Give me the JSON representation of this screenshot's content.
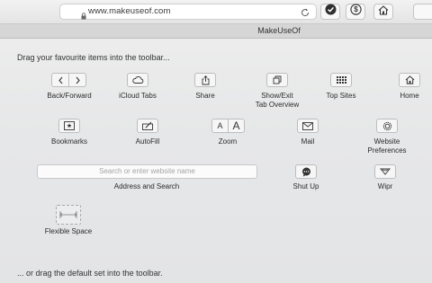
{
  "browser": {
    "url": "www.makeuseof.com",
    "tab_title": "MakeUseOf"
  },
  "customize": {
    "heading": "Drag your favourite items into the toolbar...",
    "footer": "... or drag the default set into the toolbar.",
    "search_placeholder": "Search or enter website name",
    "items": {
      "back_forward": "Back/Forward",
      "icloud_tabs": "iCloud Tabs",
      "share": "Share",
      "show_exit_line1": "Show/Exit",
      "show_exit_line2": "Tab Overview",
      "top_sites": "Top Sites",
      "home": "Home",
      "bookmarks": "Bookmarks",
      "autofill": "AutoFill",
      "zoom": "Zoom",
      "mail": "Mail",
      "website_prefs_line1": "Website",
      "website_prefs_line2": "Preferences",
      "address_search": "Address and Search",
      "shut_up": "Shut Up",
      "wipr": "Wipr",
      "flexible_space": "Flexible Space"
    }
  },
  "icons": {
    "lock": "lock-icon",
    "reload": "reload-icon",
    "extension_check": "checkmark-icon",
    "extension_s": "dollar-icon",
    "home": "home-icon"
  }
}
